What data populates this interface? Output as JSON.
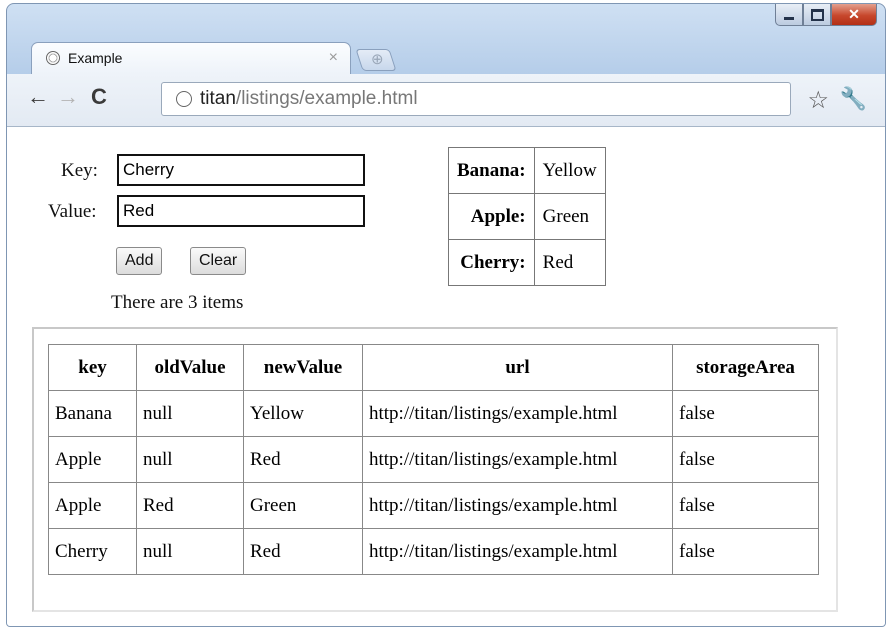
{
  "browser": {
    "tab_title": "Example",
    "tab_close": "×",
    "url_host": "titan",
    "url_path": "/listings/example.html"
  },
  "form": {
    "key_label": "Key:",
    "key_value": "Cherry",
    "value_label": "Value:",
    "value_value": "Red",
    "add_label": "Add",
    "clear_label": "Clear",
    "count_text": "There are 3 items"
  },
  "kv_table": [
    {
      "key": "Banana:",
      "value": "Yellow"
    },
    {
      "key": "Apple:",
      "value": "Green"
    },
    {
      "key": "Cherry:",
      "value": "Red"
    }
  ],
  "events_table": {
    "headers": [
      "key",
      "oldValue",
      "newValue",
      "url",
      "storageArea"
    ],
    "rows": [
      [
        "Banana",
        "null",
        "Yellow",
        "http://titan/listings/example.html",
        "false"
      ],
      [
        "Apple",
        "null",
        "Red",
        "http://titan/listings/example.html",
        "false"
      ],
      [
        "Apple",
        "Red",
        "Green",
        "http://titan/listings/example.html",
        "false"
      ],
      [
        "Cherry",
        "null",
        "Red",
        "http://titan/listings/example.html",
        "false"
      ]
    ]
  }
}
